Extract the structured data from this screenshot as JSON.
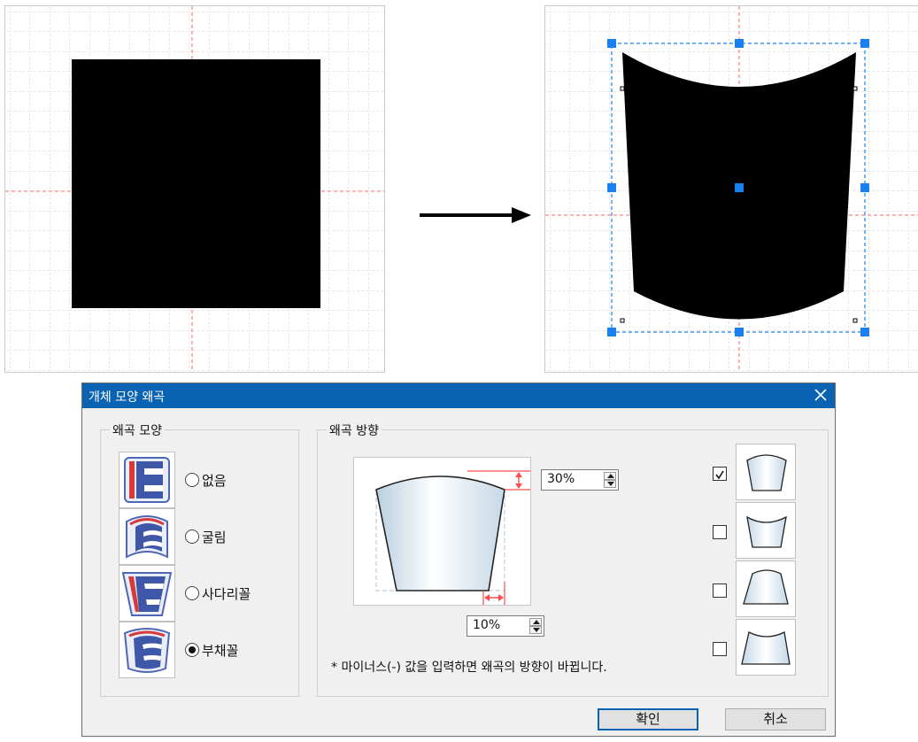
{
  "dialog": {
    "title": "개체 모양 왜곡",
    "shape_group": {
      "title": "왜곡 모양",
      "options": [
        {
          "label": "없음",
          "selected": false
        },
        {
          "label": "굴림",
          "selected": false
        },
        {
          "label": "사다리꼴",
          "selected": false
        },
        {
          "label": "부채꼴",
          "selected": true
        }
      ]
    },
    "direction_group": {
      "title": "왜곡 방향",
      "top_value": "30%",
      "side_value": "10%",
      "note": "* 마이너스(-) 값을 입력하면 왜곡의 방향이 바뀝니다.",
      "checkboxes": [
        true,
        false,
        false,
        false
      ]
    },
    "buttons": {
      "ok": "확인",
      "cancel": "취소"
    }
  },
  "colors": {
    "title_bar": "#0a62b2",
    "selection_handle": "#1a7ff0",
    "guide_line": "#ff6666",
    "marker": "#ff4d4d"
  },
  "icons": [
    "arrow-right-icon",
    "close-icon",
    "checkmark-icon",
    "spin-up-icon",
    "spin-down-icon"
  ]
}
